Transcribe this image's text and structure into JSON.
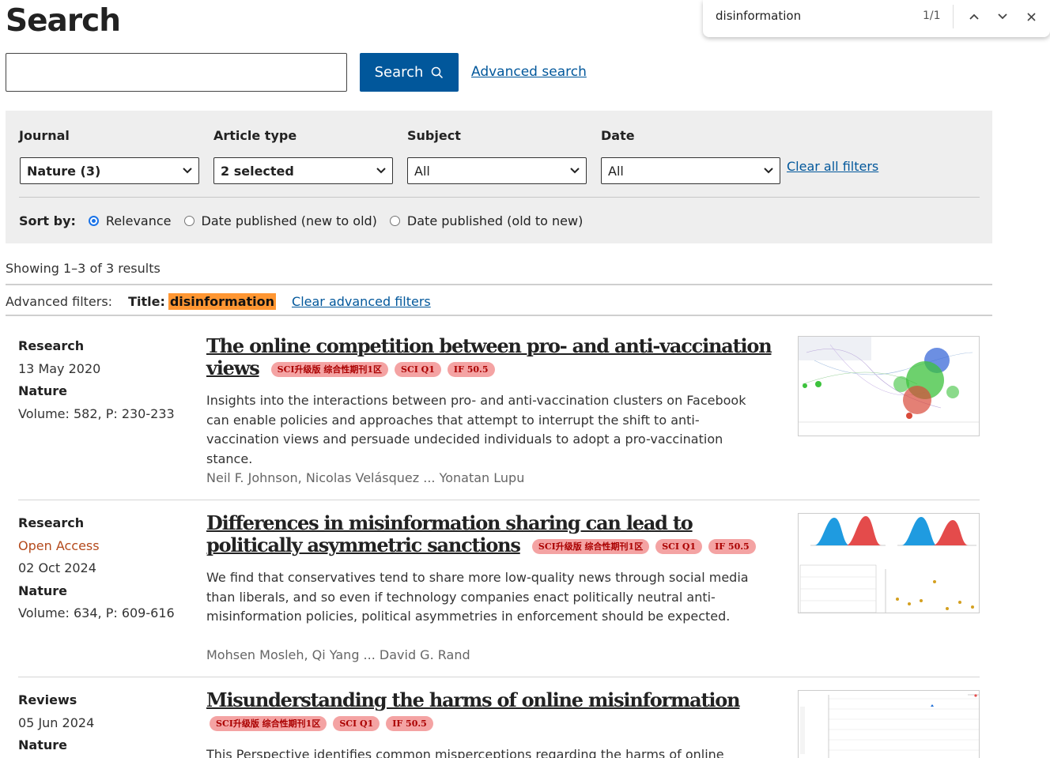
{
  "header": {
    "title": "Search"
  },
  "search": {
    "value": "",
    "button_label": "Search",
    "advanced_link": "Advanced search"
  },
  "filters": {
    "journal": {
      "label": "Journal",
      "value": "Nature (3)"
    },
    "article_type": {
      "label": "Article type",
      "value": "2 selected"
    },
    "subject": {
      "label": "Subject",
      "value": "All"
    },
    "date": {
      "label": "Date",
      "value": "All"
    },
    "clear_all": "Clear all filters",
    "sort": {
      "label": "Sort by:",
      "options": [
        "Relevance",
        "Date published (new to old)",
        "Date published (old to new)"
      ],
      "selected": "Relevance"
    }
  },
  "results": {
    "showing": "Showing 1–3 of 3 results",
    "advanced_label": "Advanced filters:",
    "advanced_title_label": "Title:",
    "advanced_title_value": "disinformation",
    "clear_advanced": "Clear advanced filters"
  },
  "articles": [
    {
      "type": "Research",
      "date": "13 May 2020",
      "journal": "Nature",
      "volume": "Volume: 582, P: 230-233",
      "title": "The online competition between pro- and anti-vaccination views",
      "badges": [
        "SCI升级版 综合性期刊1区",
        "SCI Q1",
        "IF 50.5"
      ],
      "description": "Insights into the interactions between pro- and anti-vaccination clusters on Facebook can enable policies and approaches that attempt to interrupt the shift to anti-vaccination views and persuade undecided individuals to adopt a pro-vaccination stance.",
      "authors": "Neil F. Johnson, Nicolas Velásquez ... Yonatan Lupu"
    },
    {
      "type": "Research",
      "access": "Open Access",
      "date": "02 Oct 2024",
      "journal": "Nature",
      "volume": "Volume: 634, P: 609-616",
      "title": "Differences in misinformation sharing can lead to politically asymmetric sanctions",
      "badges": [
        "SCI升级版 综合性期刊1区",
        "SCI Q1",
        "IF 50.5"
      ],
      "description": "We find that conservatives tend to share more low-quality news through social media than liberals, and so even if technology companies enact politically neutral anti-misinformation policies, political asymmetries in enforcement should be expected.",
      "authors": "Mohsen Mosleh, Qi Yang ... David G. Rand"
    },
    {
      "type": "Reviews",
      "date": "05 Jun 2024",
      "journal": "Nature",
      "title": "Misunderstanding the harms of online misinformation",
      "badges": [
        "SCI升级版 综合性期刊1区",
        "SCI Q1",
        "IF 50.5"
      ],
      "description": "This Perspective identifies common misperceptions regarding the harms of online"
    }
  ],
  "find_bar": {
    "query": "disinformation",
    "count": "1/1",
    "highlight_color": "#ff9632"
  },
  "colors": {
    "primary": "#01579b",
    "badge_bg": "#f4a3a3",
    "badge_text": "#aa0000",
    "open_access": "#b44a1c"
  }
}
